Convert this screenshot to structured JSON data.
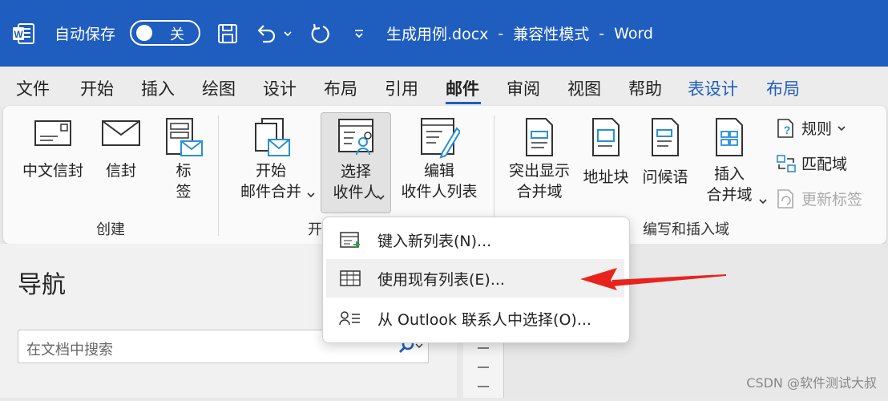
{
  "titlebar": {
    "autosave_label": "自动保存",
    "toggle_state": "关",
    "save_icon": "save-icon",
    "undo_icon": "undo-icon",
    "redo_icon": "redo-icon",
    "filename": "生成用例.docx",
    "sep1": "-",
    "mode": "兼容性模式",
    "sep2": "-",
    "app": "Word"
  },
  "tabs": [
    "文件",
    "开始",
    "插入",
    "绘图",
    "设计",
    "布局",
    "引用",
    "邮件",
    "审阅",
    "视图",
    "帮助",
    "表设计",
    "布局"
  ],
  "ribbon": {
    "create": {
      "chinese_envelope": "中文信封",
      "envelope": "信封",
      "labels_1": "标",
      "labels_2": "签",
      "group": "创建"
    },
    "start_merge": {
      "start_1": "开始",
      "start_2": "邮件合并",
      "select_1": "选择",
      "select_2": "收件人",
      "edit_1": "编辑",
      "edit_2": "收件人列表",
      "group": "开"
    },
    "write": {
      "highlight_1": "突出显示",
      "highlight_2": "合并域",
      "address": "地址块",
      "greeting": "问候语",
      "insert_1": "插入",
      "insert_2": "合并域",
      "rules": "规则",
      "match": "匹配域",
      "update": "更新标签",
      "group": "编写和插入域"
    }
  },
  "menu": [
    {
      "label": "键入新列表(N)...",
      "icon": "new-list-icon"
    },
    {
      "label": "使用现有列表(E)...",
      "icon": "existing-list-icon"
    },
    {
      "label": "从 Outlook 联系人中选择(O)...",
      "icon": "outlook-contacts-icon"
    }
  ],
  "nav": {
    "title": "导航",
    "search_placeholder": "在文档中搜索"
  },
  "watermark": "CSDN @软件测试大叔",
  "colors": {
    "title_bg": "#1f5dbf",
    "accent_red": "#e8231e"
  }
}
